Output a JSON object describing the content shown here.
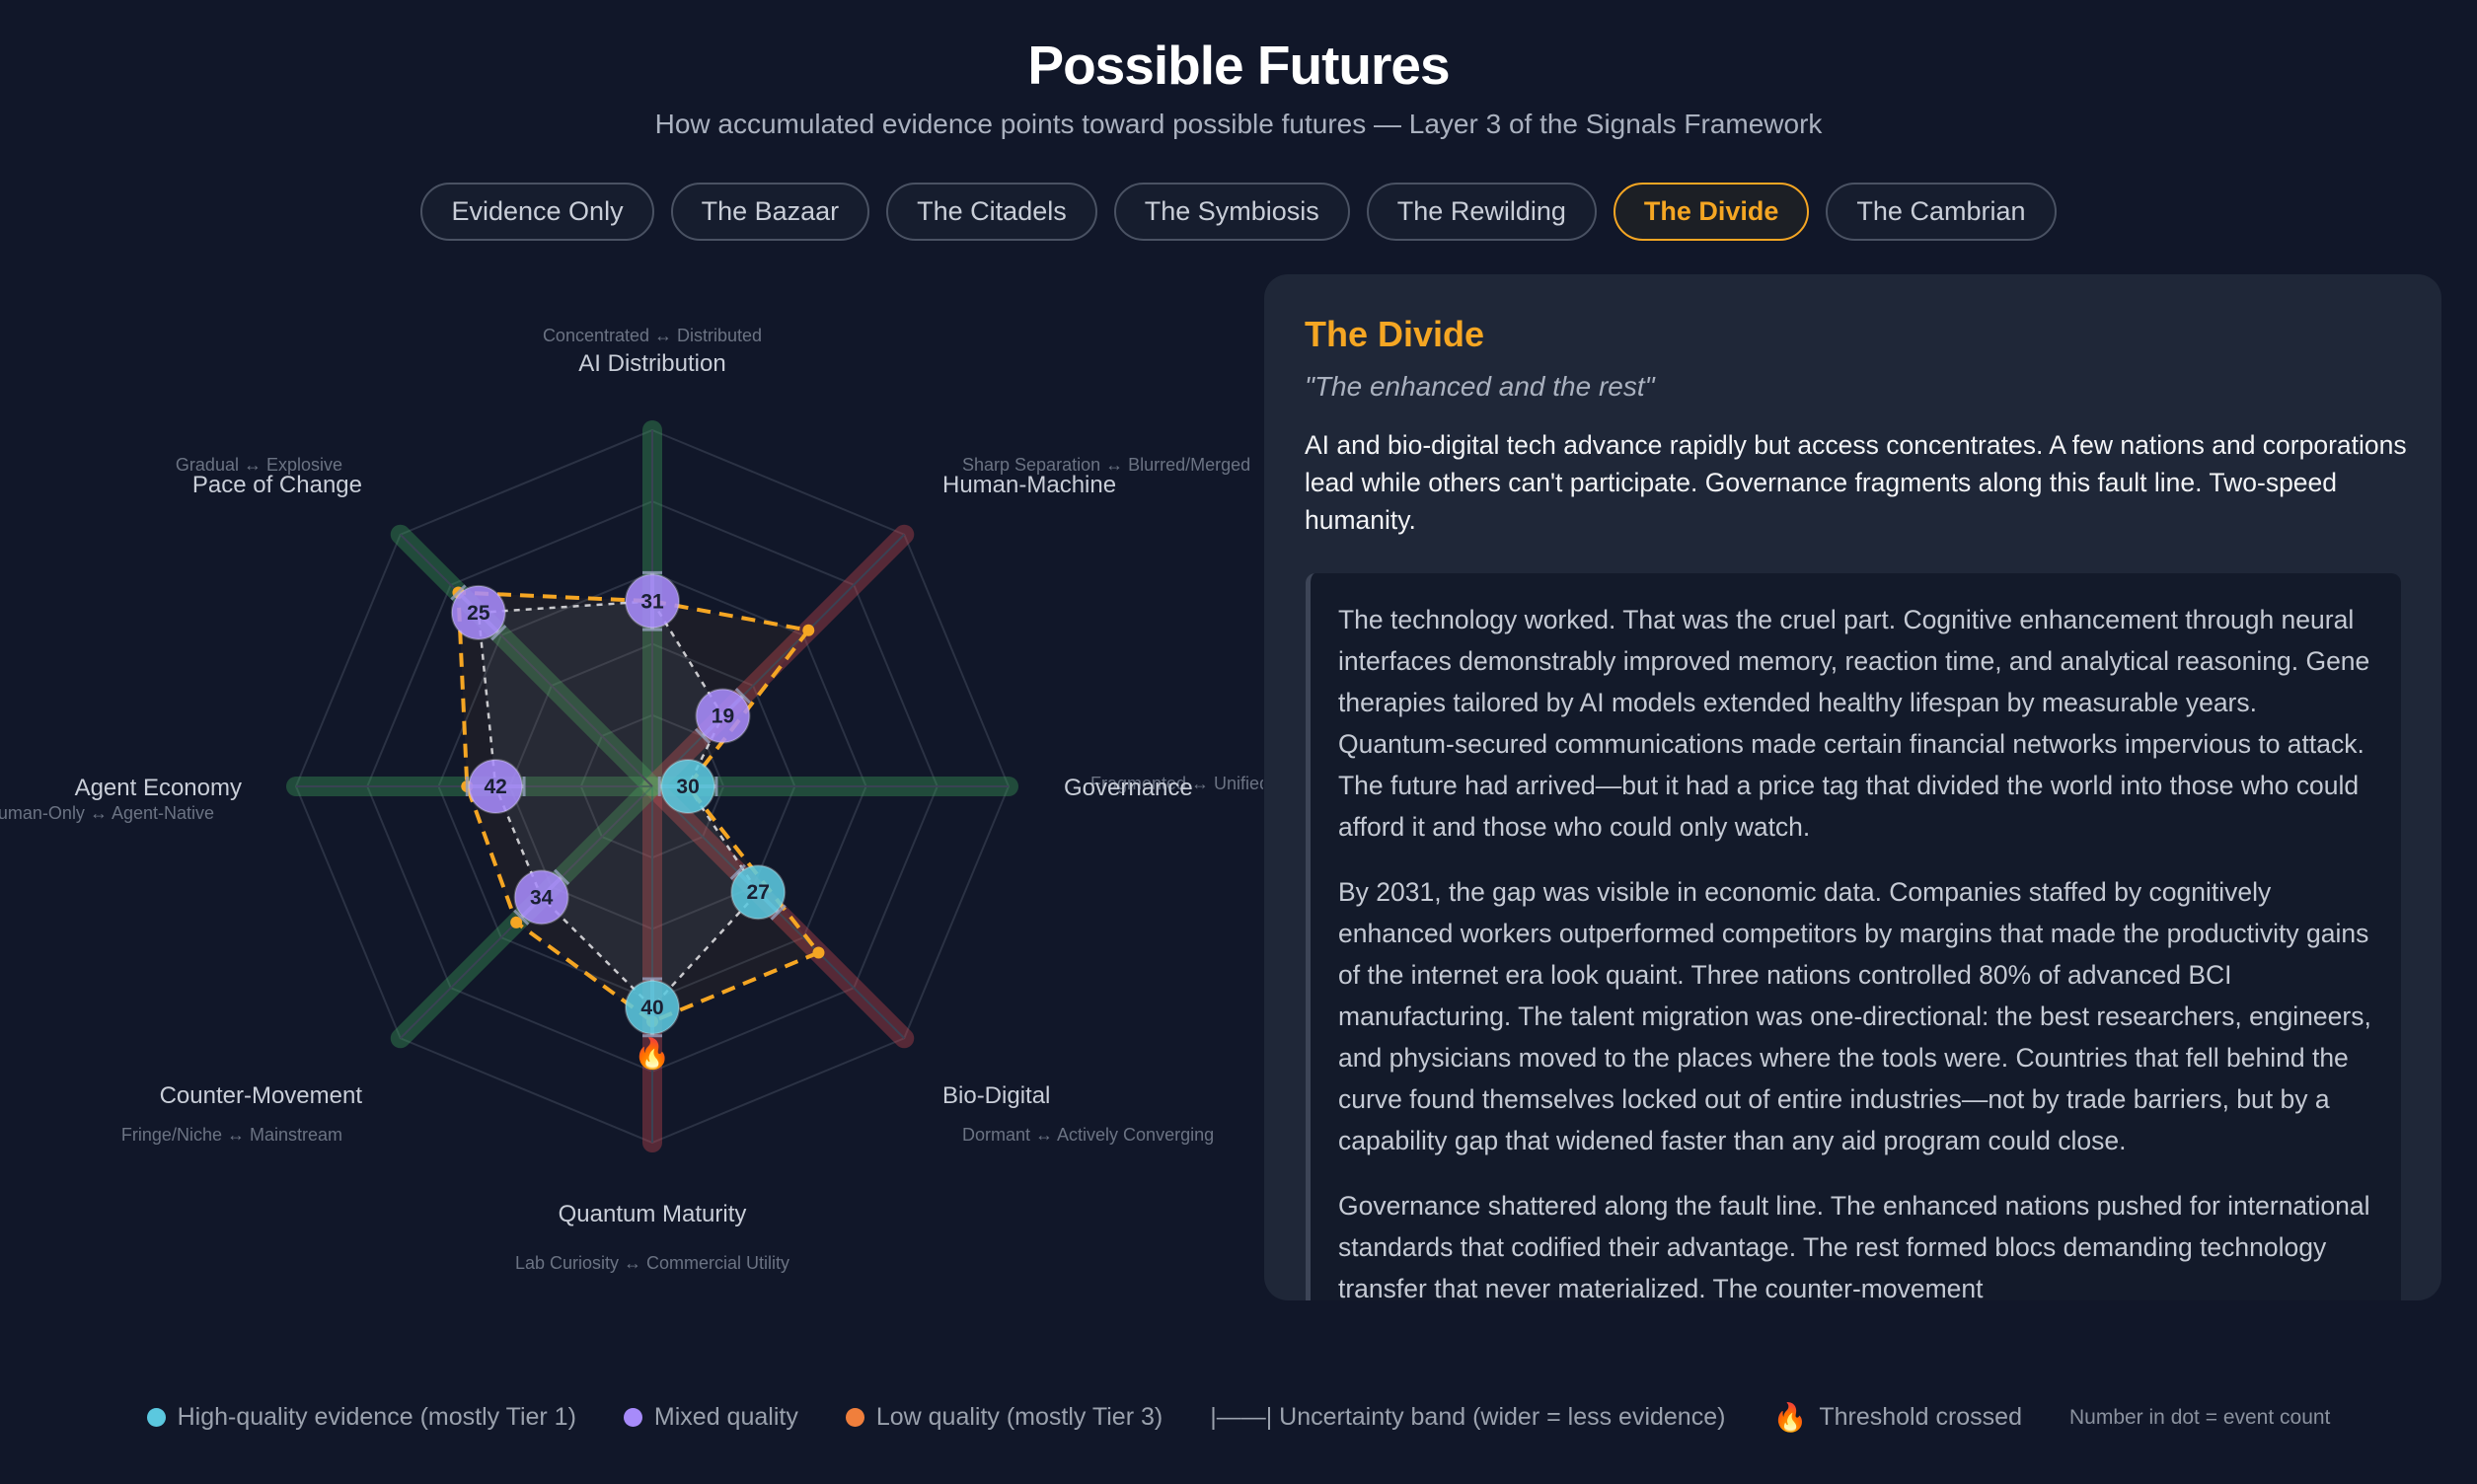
{
  "header": {
    "title": "Possible Futures",
    "subtitle": "How accumulated evidence points toward possible futures — Layer 3 of the Signals Framework"
  },
  "tabs": [
    {
      "label": "Evidence Only",
      "active": false
    },
    {
      "label": "The Bazaar",
      "active": false
    },
    {
      "label": "The Citadels",
      "active": false
    },
    {
      "label": "The Symbiosis",
      "active": false
    },
    {
      "label": "The Rewilding",
      "active": false
    },
    {
      "label": "The Divide",
      "active": true
    },
    {
      "label": "The Cambrian",
      "active": false
    }
  ],
  "colors": {
    "accent": "#f5a623",
    "high_quality": "#5bc8df",
    "mixed_quality": "#a78bfa",
    "low_quality": "#f07f3c",
    "background": "#111729",
    "panel": "#1f2738"
  },
  "radar": {
    "axes": [
      {
        "name": "AI Distribution",
        "scale": "Concentrated ↔ Distributed",
        "events": 31,
        "evidence_pos": 0.52,
        "scenario_pos": 0.52,
        "quality": "mixed",
        "tint": "green",
        "threshold": false
      },
      {
        "name": "Human-Machine",
        "scale": "Sharp Separation ↔ Blurred/Merged",
        "events": 19,
        "evidence_pos": 0.28,
        "scenario_pos": 0.62,
        "quality": "mixed",
        "tint": "red",
        "threshold": false
      },
      {
        "name": "Governance",
        "scale": "Fragmented ↔ Unified",
        "events": 30,
        "evidence_pos": 0.1,
        "scenario_pos": 0.1,
        "quality": "high",
        "tint": "green",
        "threshold": false
      },
      {
        "name": "Bio-Digital",
        "scale": "Dormant ↔ Actively Converging",
        "events": 27,
        "evidence_pos": 0.42,
        "scenario_pos": 0.66,
        "quality": "high",
        "tint": "red",
        "threshold": false
      },
      {
        "name": "Quantum Maturity",
        "scale": "Lab Curiosity ↔ Commercial Utility",
        "events": 40,
        "evidence_pos": 0.62,
        "scenario_pos": 0.66,
        "quality": "high",
        "tint": "red",
        "threshold": true
      },
      {
        "name": "Counter-Movement",
        "scale": "Fringe/Niche ↔ Mainstream",
        "events": 34,
        "evidence_pos": 0.44,
        "scenario_pos": 0.54,
        "quality": "mixed",
        "tint": "green",
        "threshold": false
      },
      {
        "name": "Agent Economy",
        "scale": "Human-Only ↔ Agent-Native",
        "events": 42,
        "evidence_pos": 0.44,
        "scenario_pos": 0.52,
        "quality": "mixed",
        "tint": "green",
        "threshold": false
      },
      {
        "name": "Pace of Change",
        "scale": "Gradual ↔ Explosive",
        "events": 25,
        "evidence_pos": 0.69,
        "scenario_pos": 0.77,
        "quality": "mixed",
        "tint": "green",
        "threshold": false
      }
    ]
  },
  "scenario": {
    "title": "The Divide",
    "tagline": "\"The enhanced and the rest\"",
    "summary": "AI and bio-digital tech advance rapidly but access concentrates. A few nations and corporations lead while others can't participate. Governance fragments along this fault line. Two-speed humanity.",
    "story": [
      "The technology worked. That was the cruel part. Cognitive enhancement through neural interfaces demonstrably improved memory, reaction time, and analytical reasoning. Gene therapies tailored by AI models extended healthy lifespan by measurable years. Quantum-secured communications made certain financial networks impervious to attack. The future had arrived—but it had a price tag that divided the world into those who could afford it and those who could only watch.",
      "By 2031, the gap was visible in economic data. Companies staffed by cognitively enhanced workers outperformed competitors by margins that made the productivity gains of the internet era look quaint. Three nations controlled 80% of advanced BCI manufacturing. The talent migration was one-directional: the best researchers, engineers, and physicians moved to the places where the tools were. Countries that fell behind the curve found themselves locked out of entire industries—not by trade barriers, but by a capability gap that widened faster than any aid program could close.",
      "Governance shattered along the fault line. The enhanced nations pushed for international standards that codified their advantage. The rest formed blocs demanding technology transfer that never materialized. The counter-movement"
    ]
  },
  "legend": {
    "high": "High-quality evidence (mostly Tier 1)",
    "mixed": "Mixed quality",
    "low": "Low quality (mostly Tier 3)",
    "band": "|——| Uncertainty band (wider = less evidence)",
    "threshold_icon": "🔥",
    "threshold": "Threshold crossed",
    "note": "Number in dot = event count"
  }
}
